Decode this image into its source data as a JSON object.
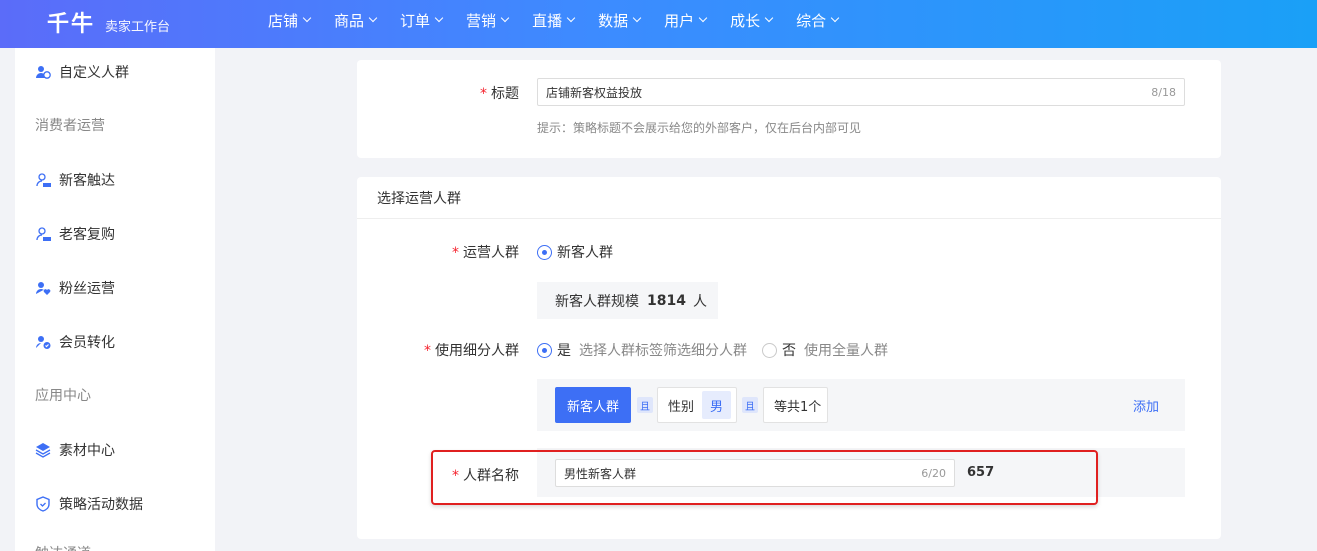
{
  "header": {
    "logo_main": "千牛",
    "logo_sub": "卖家工作台",
    "nav": [
      "店铺",
      "商品",
      "订单",
      "营销",
      "直播",
      "数据",
      "用户",
      "成长",
      "综合"
    ]
  },
  "sidebar": {
    "top_item": "自定义人群",
    "section_consumer": "消费者运营",
    "consumer_items": [
      "新客触达",
      "老客复购",
      "粉丝运营",
      "会员转化"
    ],
    "section_app": "应用中心",
    "app_items": [
      "素材中心",
      "策略活动数据"
    ],
    "section_partial": "触达通道"
  },
  "form": {
    "title": {
      "label": "标题",
      "value": "店铺新客权益投放",
      "counter": "8/18",
      "hint": "提示：策略标题不会展示给您的外部客户，仅在后台内部可见"
    },
    "section_title": "选择运营人群",
    "crowd": {
      "label": "运营人群",
      "option": "新客人群",
      "size_prefix": "新客人群规模",
      "size_value": "1814",
      "size_unit": "人"
    },
    "segment": {
      "label": "使用细分人群",
      "yes": "是",
      "yes_desc": "选择人群标签筛选细分人群",
      "no": "否",
      "no_desc": "使用全量人群",
      "selected": "是"
    },
    "filter": {
      "primary_tag": "新客人群",
      "and": "且",
      "gender_label": "性别",
      "gender_value": "男",
      "more": "等共1个",
      "add": "添加"
    },
    "crowd_name": {
      "label": "人群名称",
      "value": "男性新客人群",
      "counter": "6/20",
      "total": "657"
    }
  },
  "colors": {
    "primary": "#3d6ff5",
    "required": "#f5222d",
    "highlight": "#e02020"
  }
}
